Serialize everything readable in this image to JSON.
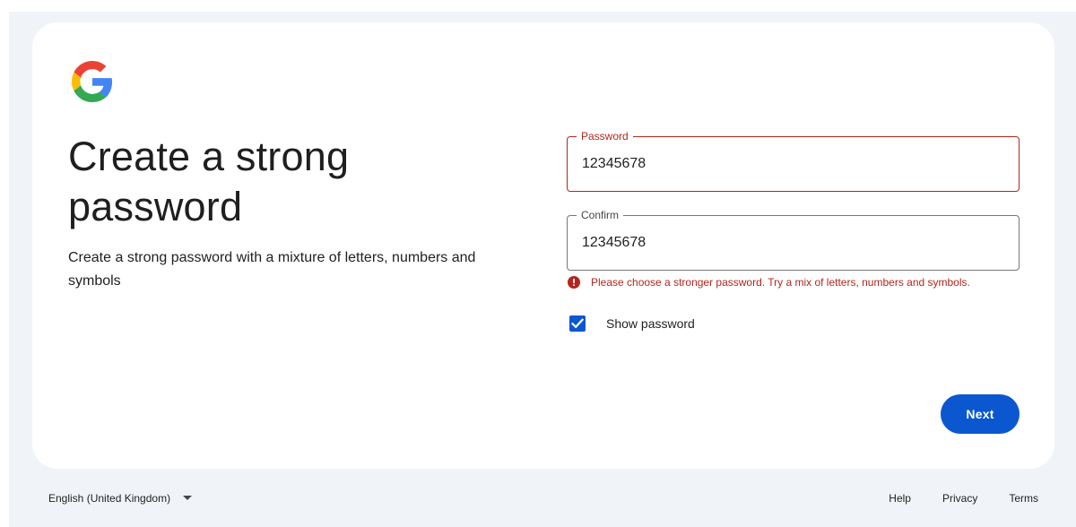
{
  "header": {
    "logo_icon": "google-g-logo",
    "title": "Create a strong password",
    "subtitle": "Create a strong password with a mixture of letters, numbers and symbols"
  },
  "form": {
    "password": {
      "label": "Password",
      "value": "12345678",
      "state": "error"
    },
    "confirm": {
      "label": "Confirm",
      "value": "12345678"
    },
    "error_icon": "error-circle-icon",
    "error_message": "Please choose a stronger password. Try a mix of letters, numbers and symbols.",
    "show_password": {
      "label": "Show password",
      "checked": true
    },
    "next_label": "Next"
  },
  "footer": {
    "language": "English (United Kingdom)",
    "links": [
      "Help",
      "Privacy",
      "Terms"
    ]
  },
  "colors": {
    "accent": "#0b57d0",
    "error": "#b3261e",
    "page_background": "#f0f4f9",
    "card_background": "#ffffff"
  }
}
